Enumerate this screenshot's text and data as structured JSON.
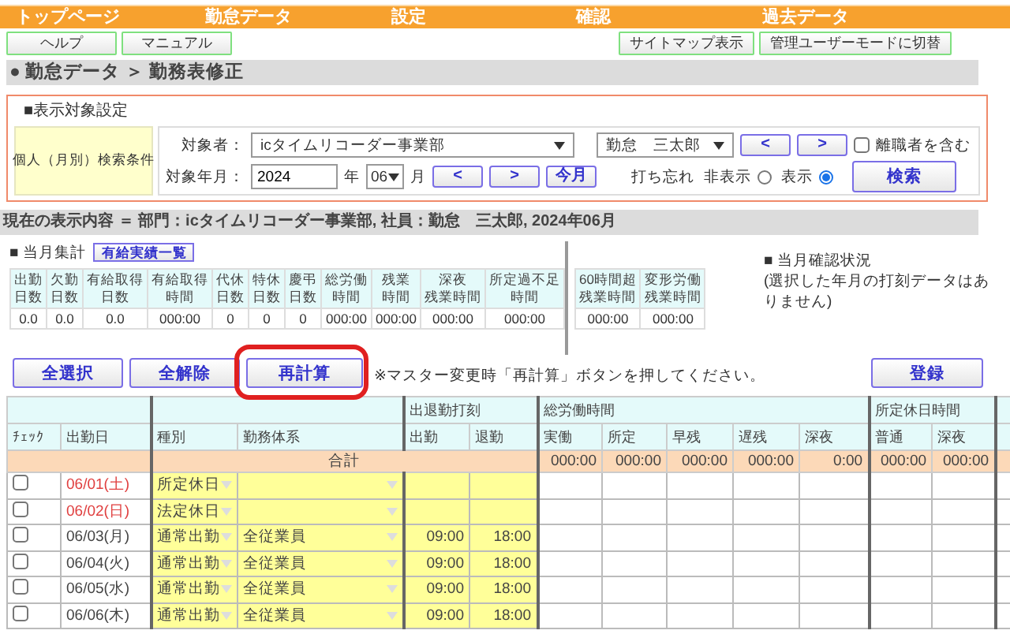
{
  "nav": [
    "トップページ",
    "勤怠データ",
    "設定",
    "確認",
    "過去データ"
  ],
  "left_buttons": [
    "ヘルプ",
    "マニュアル"
  ],
  "right_buttons": [
    "サイトマップ表示",
    "管理ユーザーモードに切替"
  ],
  "breadcrumb": "● 勤怠データ ＞ 勤務表修正",
  "filter": {
    "title": "■表示対象設定",
    "condition_label": "個人（月別）検索条件",
    "employee_label": "対象者：",
    "department": "icタイムリコーダー事業部",
    "employee": "勤怠　三太郎",
    "prev": "<",
    "next": ">",
    "include_retired": {
      "label": "離職者を含む",
      "checked": false
    },
    "year_month_label": "対象年月：",
    "year": "2024",
    "year_unit": "年",
    "month": "06",
    "month_unit": "月",
    "month_prev": "<",
    "month_next": ">",
    "this_month": "今月",
    "forgot_label": "打ち忘れ",
    "radios": [
      {
        "label": "非表示",
        "selected": false
      },
      {
        "label": "表示",
        "selected": true
      }
    ],
    "search": "検索"
  },
  "current_display": "現在の表示内容 ＝ 部門：icタイムリコーダー事業部, 社員：勤怠　三太郎, 2024年06月",
  "summary": {
    "title": "■ 当月集計",
    "button": "有給実績一覧",
    "columns": [
      [
        "出勤",
        "日数"
      ],
      [
        "欠勤",
        "日数"
      ],
      [
        "有給取得",
        "日数"
      ],
      [
        "有給取得",
        "時間"
      ],
      [
        "代休",
        "日数"
      ],
      [
        "特休",
        "日数"
      ],
      [
        "慶弔",
        "日数"
      ],
      [
        "総労働",
        "時間"
      ],
      [
        "残業",
        "時間"
      ],
      [
        "深夜",
        "残業時間"
      ],
      [
        "所定過不足",
        "時間"
      ]
    ],
    "values": [
      "0.0",
      "0.0",
      "0.0",
      "000:00",
      "0",
      "0",
      "0",
      "000:00",
      "000:00",
      "000:00",
      "000:00"
    ]
  },
  "overtime": {
    "columns": [
      [
        "60時間超",
        "残業時間"
      ],
      [
        "変形労働",
        "残業時間"
      ]
    ],
    "values": [
      "000:00",
      "000:00"
    ]
  },
  "status": {
    "title": "■ 当月確認状況",
    "message": "(選択した年月の打刻データはありません)"
  },
  "actions": [
    "全選択",
    "全解除",
    "再計算"
  ],
  "note": "※マスター変更時「再計算」ボタンを押してください。",
  "register": "登録",
  "table": {
    "groups": [
      "出退勤打刻",
      "総労働時間",
      "所定休日時間"
    ],
    "columns": [
      "ﾁｪｯｸ",
      "出勤日",
      "種別",
      "勤務体系",
      "出勤",
      "退勤",
      "実働",
      "所定",
      "早残",
      "遅残",
      "深夜",
      "普通",
      "深夜"
    ],
    "total_label": "合計",
    "totals": [
      "000:00",
      "000:00",
      "000:00",
      "000:00",
      "0:00",
      "000:00",
      "000:00"
    ],
    "rows": [
      {
        "checked": false,
        "date": "06/01(土)",
        "holiday": true,
        "type": "所定休日",
        "in": "",
        "out": ""
      },
      {
        "checked": false,
        "date": "06/02(日)",
        "holiday": true,
        "type": "法定休日",
        "in": "",
        "out": ""
      },
      {
        "checked": false,
        "date": "06/03(月)",
        "holiday": false,
        "type": "通常出勤",
        "pattern": "全従業員",
        "in": "09:00",
        "out": "18:00"
      },
      {
        "checked": false,
        "date": "06/04(火)",
        "holiday": false,
        "type": "通常出勤",
        "pattern": "全従業員",
        "in": "09:00",
        "out": "18:00"
      },
      {
        "checked": false,
        "date": "06/05(水)",
        "holiday": false,
        "type": "通常出勤",
        "pattern": "全従業員",
        "in": "09:00",
        "out": "18:00"
      },
      {
        "checked": false,
        "date": "06/06(木)",
        "holiday": false,
        "type": "通常出勤",
        "pattern": "全従業員",
        "in": "09:00",
        "out": "18:00"
      }
    ]
  }
}
